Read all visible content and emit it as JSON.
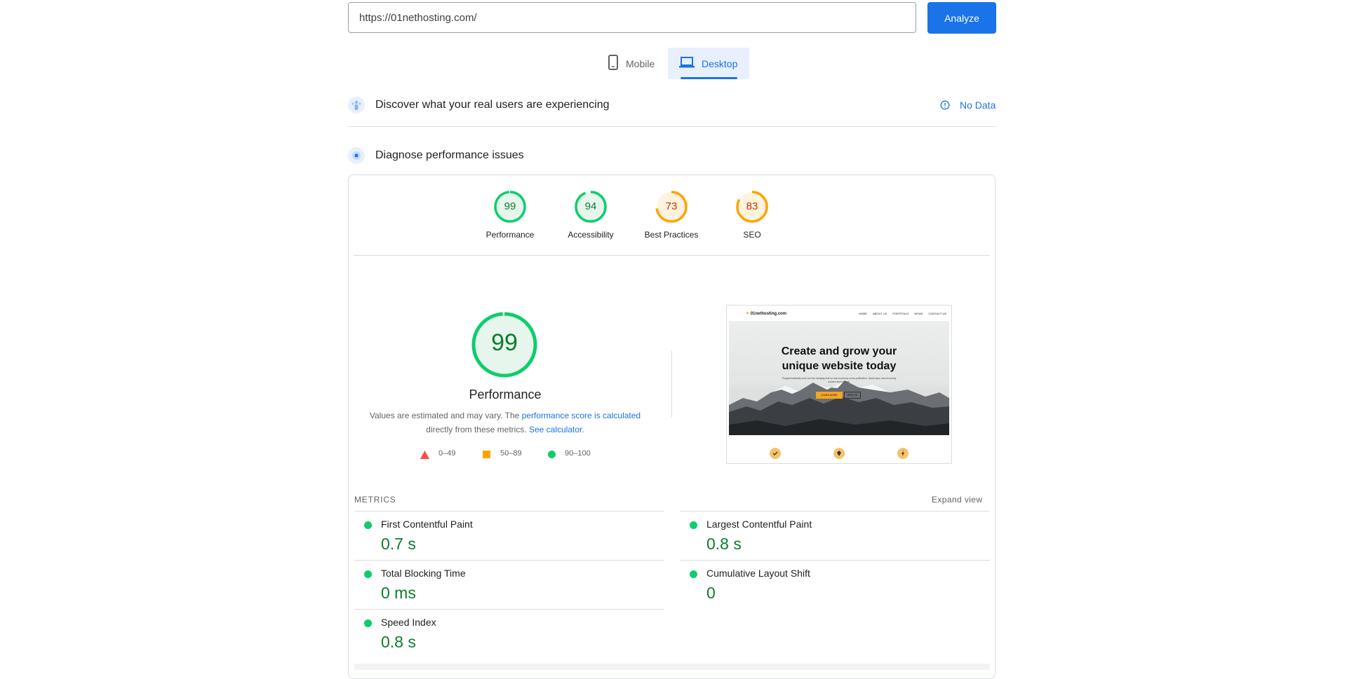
{
  "search": {
    "url_value": "https://01nethosting.com/",
    "analyze_label": "Analyze"
  },
  "tabs": [
    {
      "label": "Mobile"
    },
    {
      "label": "Desktop",
      "active": true
    }
  ],
  "field_data": {
    "title": "Discover what your real users are experiencing",
    "status": "No Data"
  },
  "lab_data": {
    "title": "Diagnose performance issues"
  },
  "scores": [
    {
      "value": "99",
      "label": "Performance",
      "color": "#0cce6b"
    },
    {
      "value": "94",
      "label": "Accessibility",
      "color": "#0cce6b"
    },
    {
      "value": "73",
      "label": "Best Practices",
      "color": "#ffa400"
    },
    {
      "value": "83",
      "label": "SEO",
      "color": "#ffa400"
    }
  ],
  "main_gauge": {
    "value": "99",
    "label": "Performance"
  },
  "description": {
    "prefix": "Values are estimated and may vary. The ",
    "link1": "performance score is calculated",
    "middle": "directly from these metrics. ",
    "link2": "See calculator."
  },
  "legend": [
    {
      "range": "0–49",
      "color": "#ff4e42"
    },
    {
      "range": "50–89",
      "color": "#ffa400"
    },
    {
      "range": "90–100",
      "color": "#0cce6b"
    }
  ],
  "screenshot": {
    "logo": "01nethosting.com",
    "nav": [
      "HOME",
      "ABOUT US",
      "PORTFOLIO",
      "NEWS",
      "CONTACT US"
    ],
    "headline_line1": "Create and grow your",
    "headline_line2": "unique website today",
    "subtext": "Programmatically work but low hanging fruit so new economy cross-pollination. Quick sync new economy onward and upward.",
    "btn1": "LEARN MORE",
    "btn2": "HIRE US"
  },
  "metrics": {
    "header": "METRICS",
    "expand": "Expand view",
    "items": [
      {
        "label": "First Contentful Paint",
        "value": "0.7 s"
      },
      {
        "label": "Largest Contentful Paint",
        "value": "0.8 s"
      },
      {
        "label": "Total Blocking Time",
        "value": "0 ms"
      },
      {
        "label": "Cumulative Layout Shift",
        "value": "0"
      },
      {
        "label": "Speed Index",
        "value": "0.8 s"
      }
    ]
  }
}
